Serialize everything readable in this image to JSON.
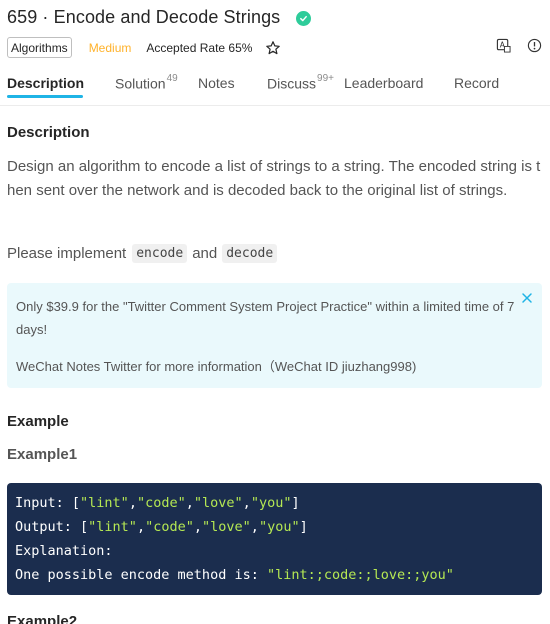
{
  "problem": {
    "title": "659 · Encode and Decode Strings",
    "tag": "Algorithms",
    "difficulty": "Medium",
    "accepted_rate": "Accepted Rate 65%"
  },
  "tabs": [
    {
      "label": "Description",
      "badge": ""
    },
    {
      "label": "Solution",
      "badge": "49"
    },
    {
      "label": "Notes",
      "badge": ""
    },
    {
      "label": "Discuss",
      "badge": "99+"
    },
    {
      "label": "Leaderboard",
      "badge": ""
    },
    {
      "label": "Record",
      "badge": ""
    }
  ],
  "description": {
    "heading": "Description",
    "text": "Design an algorithm to encode a list of strings to a string. The encoded string is then sent over the network and is decoded back to the original list of strings.",
    "implement_prefix": "Please implement",
    "code1": "encode",
    "and": "and",
    "code2": "decode"
  },
  "notice": {
    "text": "Only $39.9 for the \"Twitter Comment System Project Practice\" within a limited time of 7 days!",
    "text2": "WeChat Notes Twitter for more information（WeChat ID jiuzhang998)"
  },
  "example": {
    "heading": "Example",
    "example1": "Example1",
    "input_label": "Input: ",
    "output_label": "Output: ",
    "explanation_label": "Explanation:",
    "method_label": "One possible encode method is: ",
    "method_value": "\"lint:;code:;love:;you\"",
    "strings": [
      "\"lint\"",
      "\"code\"",
      "\"love\"",
      "\"you\""
    ],
    "example2": "Example2"
  },
  "colors": {
    "accent": "#1fb4e6",
    "medium": "#ffb22b",
    "success": "#2ecc9a",
    "code_bg": "#1b2d4e",
    "code_string": "#b5e853"
  }
}
